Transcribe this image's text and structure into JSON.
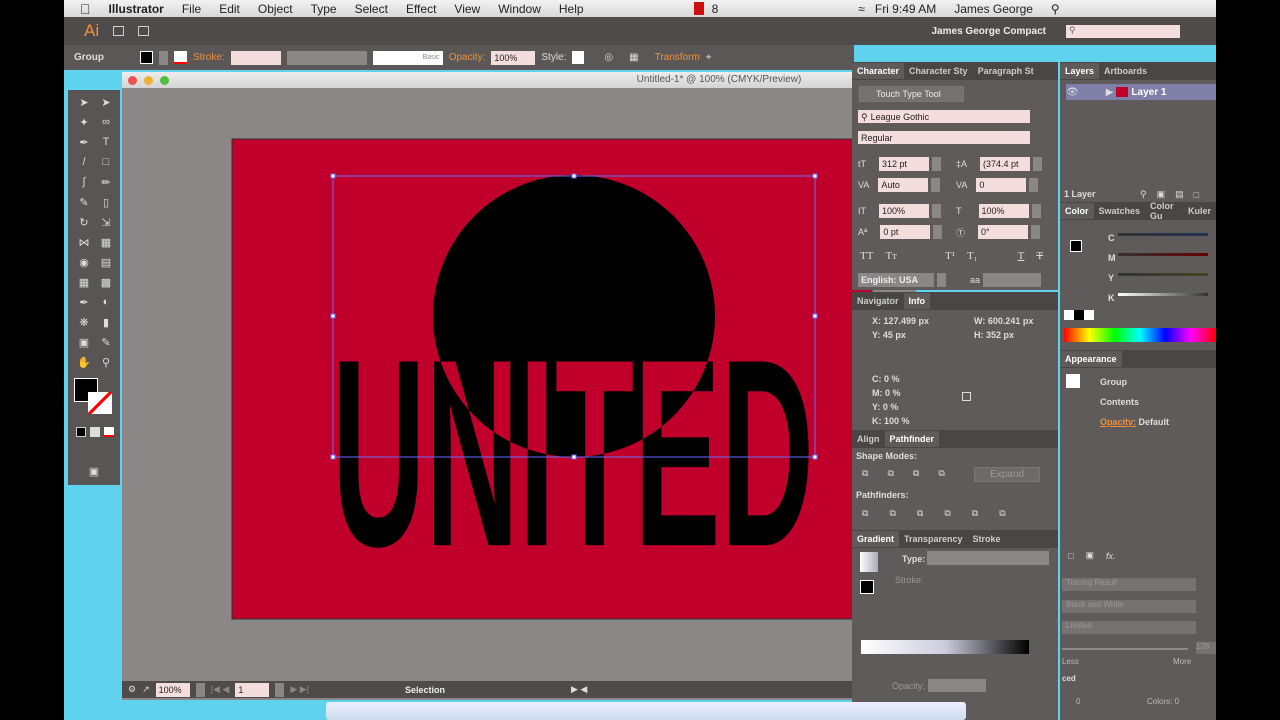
{
  "menubar": {
    "app": "Illustrator",
    "items": [
      "File",
      "Edit",
      "Object",
      "Type",
      "Select",
      "Effect",
      "View",
      "Window",
      "Help"
    ],
    "clock": "Fri 9:49 AM",
    "user": "James George",
    "status_num": "8"
  },
  "appbar": {
    "logo": "Ai",
    "workspace": "James George Compact",
    "search_placeholder": ""
  },
  "control": {
    "selection": "Group",
    "stroke_label": "Stroke:",
    "brush": "Basic",
    "opacity_label": "Opacity:",
    "opacity": "100%",
    "style_label": "Style:",
    "transform": "Transform"
  },
  "document": {
    "title": "Untitled-1* @ 100% (CMYK/Preview)",
    "artwork_text": "UNITED",
    "artboard_color": "#c0002a"
  },
  "status": {
    "zoom": "100%",
    "artboard": "1",
    "tool": "Selection"
  },
  "character": {
    "tabs": [
      "Character",
      "Character Sty",
      "Paragraph St"
    ],
    "touch_type": "Touch Type Tool",
    "font": "League Gothic",
    "style": "Regular",
    "size": "312 pt",
    "leading": "(374.4 pt",
    "kerning": "Auto",
    "tracking": "0",
    "vscale": "100%",
    "hscale": "100%",
    "baseline": "0 pt",
    "rotation": "0°",
    "language": "English: USA"
  },
  "info": {
    "tabs": [
      "Navigator",
      "Info"
    ],
    "x": "X: 127.499 px",
    "y": "Y: 45 px",
    "w": "W: 600.241 px",
    "h": "H: 352 px",
    "c": "C: 0 %",
    "m": "M: 0 %",
    "yv": "Y: 0 %",
    "k": "K: 100 %"
  },
  "pathfinder": {
    "tabs": [
      "Align",
      "Pathfinder"
    ],
    "shape_modes": "Shape Modes:",
    "expand": "Expand",
    "pathfinders": "Pathfinders:"
  },
  "gradient": {
    "tabs": [
      "Gradient",
      "Transparency",
      "Stroke"
    ],
    "type": "Type:",
    "stroke": "Stroke:",
    "opacity": "Opacity:"
  },
  "layers": {
    "tabs": [
      "Layers",
      "Artboards"
    ],
    "layer": "Layer 1",
    "count": "1 Layer"
  },
  "color": {
    "tabs": [
      "Color",
      "Swatches",
      "Color Gu",
      "Kuler"
    ],
    "channels": [
      "C",
      "M",
      "Y",
      "K"
    ]
  },
  "appearance": {
    "title": "Appearance",
    "group": "Group",
    "contents": "Contents",
    "opacity_label": "Opacity:",
    "opacity_value": "Default"
  },
  "trace": {
    "preset": "Tracing Result",
    "mode": "Black and White",
    "palette": "Limited",
    "threshold": "128",
    "less": "Less",
    "more": "More",
    "advanced": "ced",
    "colors": "Colors: 0",
    "zero": "0"
  }
}
